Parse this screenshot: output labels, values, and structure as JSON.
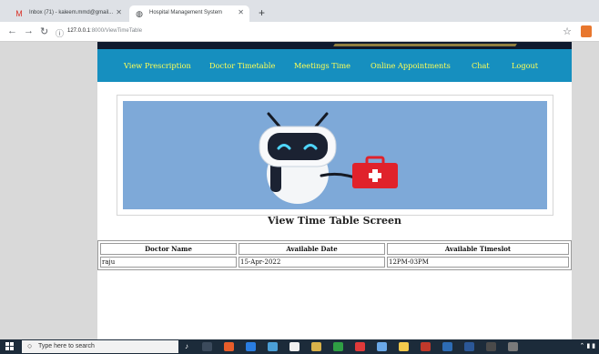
{
  "browser": {
    "tabs": [
      {
        "label": "Inbox (71) - kaleem.mmd@gmail...",
        "favicon": "gmail-icon",
        "active": false
      },
      {
        "label": "Hospital Management System",
        "favicon": "globe-icon",
        "active": true
      }
    ],
    "address": {
      "host": "127.0.0.1",
      "path": ":8000/ViewTimeTable"
    }
  },
  "nav": {
    "items": [
      "View Prescription",
      "Doctor Timetable",
      "Meetings Time",
      "Online Appointments",
      "Chat",
      "Logout"
    ]
  },
  "page": {
    "heading": "View Time Table Screen"
  },
  "table": {
    "columns": [
      "Doctor Name",
      "Available Date",
      "Available Timeslot"
    ],
    "rows": [
      [
        "raju",
        "15-Apr-2022",
        "12PM-03PM"
      ]
    ]
  },
  "taskbar": {
    "search_placeholder": "Type here to search"
  },
  "colors": {
    "menu_bg": "#168fbf",
    "menu_text": "#ffff55",
    "hero_bg": "#7ea9d8",
    "medkit": "#e0222b"
  }
}
